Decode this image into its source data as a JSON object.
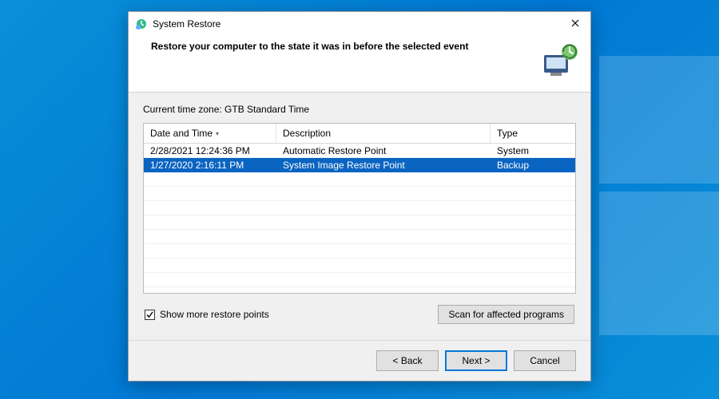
{
  "window": {
    "title": "System Restore",
    "heading": "Restore your computer to the state it was in before the selected event"
  },
  "content": {
    "timezone_label": "Current time zone: GTB Standard Time",
    "columns": {
      "date": "Date and Time",
      "description": "Description",
      "type": "Type"
    },
    "rows": [
      {
        "date": "2/28/2021 12:24:36 PM",
        "description": "Automatic Restore Point",
        "type": "System",
        "selected": false
      },
      {
        "date": "1/27/2020 2:16:11 PM",
        "description": "System Image Restore Point",
        "type": "Backup",
        "selected": true
      }
    ],
    "show_more_label": "Show more restore points",
    "show_more_checked": true,
    "scan_button": "Scan for affected programs"
  },
  "footer": {
    "back": "< Back",
    "next": "Next >",
    "cancel": "Cancel"
  }
}
